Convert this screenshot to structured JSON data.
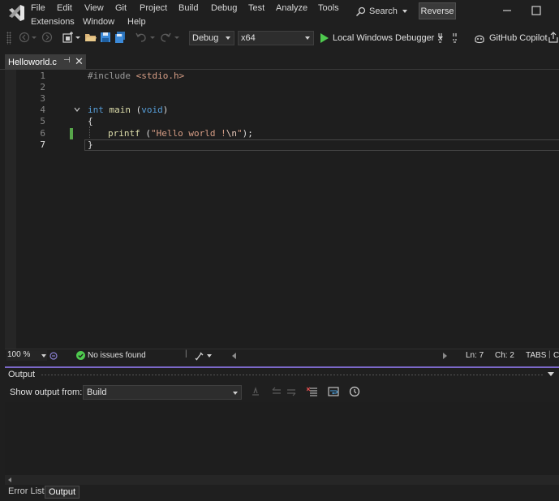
{
  "menu": {
    "row1": [
      "File",
      "Edit",
      "View",
      "Git",
      "Project",
      "Build",
      "Debug",
      "Test",
      "Analyze",
      "Tools"
    ],
    "row2": [
      "Extensions",
      "Window",
      "Help"
    ],
    "search_label": "Search",
    "reverse_label": "Reverse"
  },
  "toolbar": {
    "configuration": "Debug",
    "platform": "x64",
    "debugger_label": "Local Windows Debugger",
    "copilot_label": "GitHub Copilot"
  },
  "tabs": [
    {
      "label": "Helloworld.c",
      "active": true
    }
  ],
  "editor": {
    "line_numbers": [
      "1",
      "2",
      "3",
      "4",
      "5",
      "6",
      "7"
    ],
    "current_line": "7",
    "lines": {
      "l1_directive": "#include ",
      "l1_header": "<stdio.h>",
      "l4_kw1": "int",
      "l4_fn": " main ",
      "l4_paren": "(",
      "l4_kw2": "void",
      "l4_close": ")",
      "l5": "{",
      "l6_fn": "printf",
      "l6_open": " (",
      "l6_str": "\"Hello world !",
      "l6_esc": "\\n",
      "l6_str_end": "\"",
      "l6_close": ");",
      "l7": "}"
    }
  },
  "editor_status": {
    "zoom": "100 %",
    "issues": "No issues found",
    "line": "Ln: 7",
    "col": "Ch: 2",
    "indent": "TABS",
    "extra": "C"
  },
  "output": {
    "title": "Output",
    "show_from_label": "Show output from:",
    "source": "Build"
  },
  "bottom_tabs": [
    "Error List",
    "Output"
  ],
  "colors": {
    "accent": "#7b68c8",
    "keyword": "#569cd6",
    "string": "#d69d85",
    "run_green": "#4ec94e",
    "change_bar": "#57a64a"
  }
}
